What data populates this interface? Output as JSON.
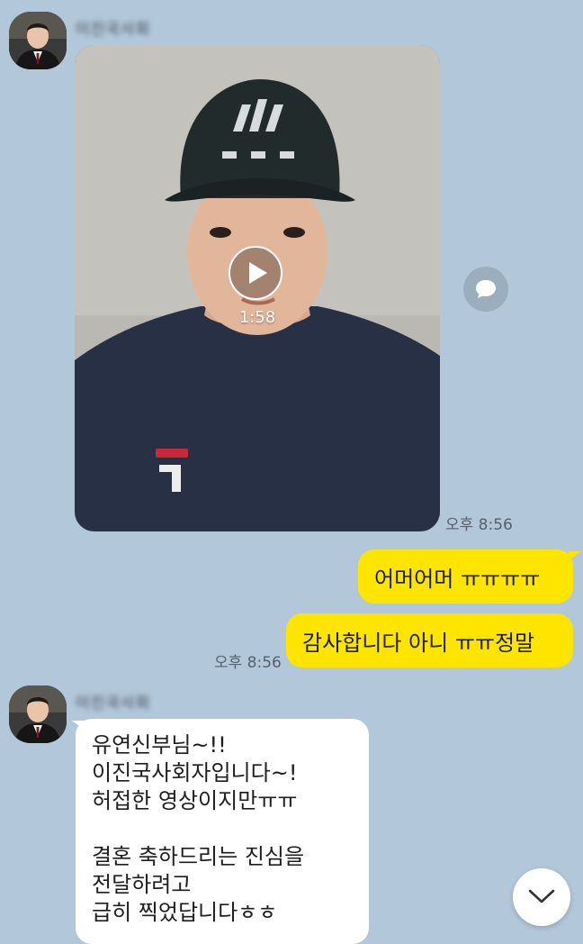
{
  "messages": {
    "video": {
      "duration": "1:58",
      "time": "오후 8:56"
    },
    "sent": {
      "line1": "어머어머 ㅠㅠㅠㅠ",
      "line2": "감사합니다 아니 ㅠㅠ정말",
      "time": "오후 8:56"
    },
    "received": {
      "lines": [
        "유연신부님~!!",
        "이진국사회자입니다~!",
        "허접한 영상이지만ㅠㅠ",
        "",
        "결혼 축하드리는 진심을",
        "전달하려고",
        "급히 찍었답니다ㅎㅎ"
      ]
    }
  },
  "icons": {
    "play": "play-icon",
    "share": "speech-bubble-icon",
    "scroll": "chevron-down-icon",
    "avatar": "profile-avatar"
  },
  "colors": {
    "background": "#b2c7d9",
    "my_bubble": "#fee500",
    "other_bubble": "#ffffff"
  }
}
